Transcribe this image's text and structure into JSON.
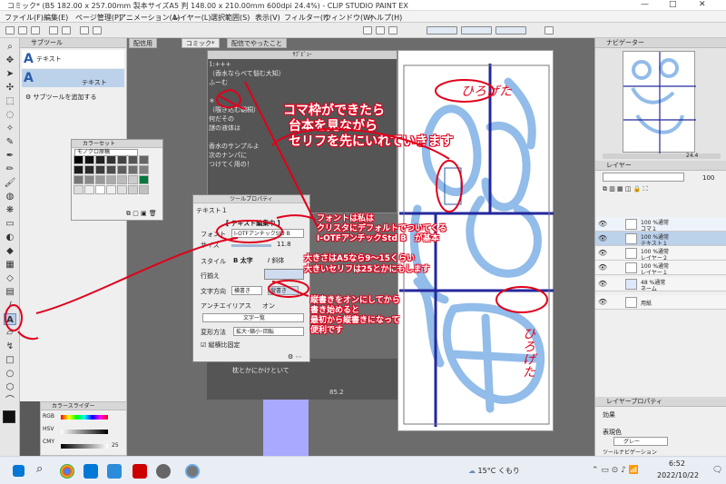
{
  "window": {
    "title": "コミック* (B5 182.00 x 257.00mm 製本サイズA5 判 148.00 x 210.00mm 600dpi 24.4%) - CLIP STUDIO PAINT EX",
    "minimize": "—",
    "maximize": "□",
    "close": "✕"
  },
  "menu": [
    "ファイル(F)",
    "編集(E)",
    "ページ管理(P)",
    "アニメーション(A)",
    "レイヤー(L)",
    "選択範囲(S)",
    "表示(V)",
    "フィルター(I)",
    "ウィンドウ(W)",
    "ヘルプ(H)"
  ],
  "subtool": {
    "header": "サブツール",
    "items": [
      {
        "icon": "A",
        "label": "テキスト"
      },
      {
        "icon": "A",
        "label": "テキスト"
      }
    ],
    "add_label": "サブツールを追加する"
  },
  "canvas_tabs": [
    "配信用",
    "コミック*",
    "配信でやったこと"
  ],
  "story": {
    "header": "ｻﾌﾞﾋﾞｭｰ",
    "lines": [
      "1:+++",
      "（香水ならべて悩む大知）",
      "ふーむ",
      "",
      "＊",
      "（覗き込む朝桐）",
      "何だその",
      "謎の液体は",
      "",
      "香水のサンプルよ",
      "次のナンパに",
      "つけてく用の！"
    ],
    "bottom_line": "枕とかにかけといて"
  },
  "colorset": {
    "header": "カラーセット",
    "selector": "モノクロ原稿",
    "swatch_colors": [
      "#000000",
      "#111111",
      "#222222",
      "#333333",
      "#444444",
      "#555555",
      "#666666",
      "#1a1a1a",
      "#2b2b2b",
      "#3c3c3c",
      "#4d4d4d",
      "#5e5e5e",
      "#6f6f6f",
      "#808080",
      "#777777",
      "#888888",
      "#999999",
      "#aaaaaa",
      "#bbbbbb",
      "#cccccc",
      "#007a3d",
      "#dddddd",
      "#eeeeee",
      "#ffffff",
      "#f0f0f0",
      "#e0e0e0",
      "#d0d0d0",
      "#c0c0c0"
    ]
  },
  "toolprop": {
    "header": "ツールプロパティ",
    "sub": "テキスト１",
    "edit_label": "【 テキスト編集中 】",
    "font_label": "フォント",
    "font_value": "I-OTFアンチックStd B",
    "size_label": "サイズ",
    "size_value": "11.8",
    "style_label": "スタイル",
    "bold_label": "太字",
    "italic_label": "斜体",
    "align_label": "行揃え",
    "direction_label": "文字方向",
    "horizontal_label": "横書き",
    "vertical_label": "縦書き",
    "antialias_label": "アンチエイリアス",
    "antialias_value": "オン",
    "char_panel": "文字一覧",
    "transform_label": "変形方法",
    "transform_value": "拡大･縮小･回転",
    "keep_ratio_label": "縦横比固定"
  },
  "navigator": {
    "header": "ナビゲーター",
    "zoom": "24.4"
  },
  "layers": {
    "header": "レイヤー",
    "opacity": "100",
    "rows": [
      {
        "pct": "100 %通常",
        "name": "コマ１"
      },
      {
        "pct": "100 %通常",
        "name": "テキスト１"
      },
      {
        "pct": "100 %通常",
        "name": "レイヤー２"
      },
      {
        "pct": "100 %通常",
        "name": "レイヤー１"
      },
      {
        "pct": "48 %通常",
        "name": "ネーム"
      },
      {
        "pct": "",
        "name": "用紙"
      }
    ]
  },
  "layerprop": {
    "header": "レイヤープロパティ",
    "effect_label": "効果",
    "color_label": "表現色",
    "color_value": "グレー",
    "toolnav": "ツールナビゲーション"
  },
  "colorslider": {
    "header": "カラースライダー",
    "modes": [
      "RGB",
      "HSV",
      "CMY"
    ],
    "value": "25"
  },
  "canvas_status": {
    "zoom": "85.2"
  },
  "annotations": {
    "main": [
      "コマ枠ができたら",
      "台本を見ながら",
      "セリフを先にいれていきます"
    ],
    "font_note": [
      "フォントは私は",
      "クリスタにデフォルトでついてくる",
      "I-OTFアンチックStd B　が基本"
    ],
    "size_note": [
      "大きさはA5なら9～15くらい",
      "大きいセリフは25とかにもします"
    ],
    "vertical_note": [
      "縦書きをオンにしてから",
      "書き始めると",
      "最初から縦書きになって",
      "便利です"
    ],
    "hand1": "ひろげた",
    "hand2": "ひろげた"
  },
  "taskbar": {
    "weather": "15°C くもり",
    "time": "6:52",
    "date": "2022/10/22"
  }
}
